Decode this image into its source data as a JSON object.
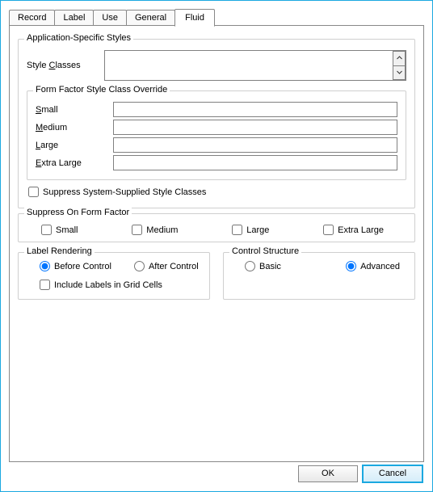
{
  "tabs": [
    "Record",
    "Label",
    "Use",
    "General",
    "Fluid"
  ],
  "active_tab": "Fluid",
  "group_app": {
    "legend": "Application-Specific Styles",
    "style_classes_label_pre": "Style ",
    "style_classes_label_u": "C",
    "style_classes_label_post": "lasses",
    "style_classes_value": ""
  },
  "group_ff": {
    "legend": "Form Factor Style Class Override",
    "rows": {
      "small": {
        "label_u": "S",
        "label_post": "mall",
        "value": ""
      },
      "medium": {
        "label_u": "M",
        "label_post": "edium",
        "value": ""
      },
      "large": {
        "label_u": "L",
        "label_post": "arge",
        "value": ""
      },
      "xlarge": {
        "label_u": "E",
        "label_post": "xtra Large",
        "value": ""
      }
    }
  },
  "suppress_sys_label": "Suppress System-Supplied Style Classes",
  "suppress_sys_checked": false,
  "group_suppress": {
    "legend": "Suppress On Form Factor",
    "small": "Small",
    "medium": "Medium",
    "large": "Large",
    "xlarge": "Extra Large",
    "small_checked": false,
    "medium_checked": false,
    "large_checked": false,
    "xlarge_checked": false
  },
  "group_label_rendering": {
    "legend": "Label Rendering",
    "before": "Before Control",
    "after": "After Control",
    "selected": "before",
    "include_labels_label": "Include Labels in Grid Cells",
    "include_labels_checked": false
  },
  "group_control_structure": {
    "legend": "Control Structure",
    "basic": "Basic",
    "advanced": "Advanced",
    "selected": "advanced"
  },
  "footer": {
    "ok": "OK",
    "cancel": "Cancel"
  }
}
